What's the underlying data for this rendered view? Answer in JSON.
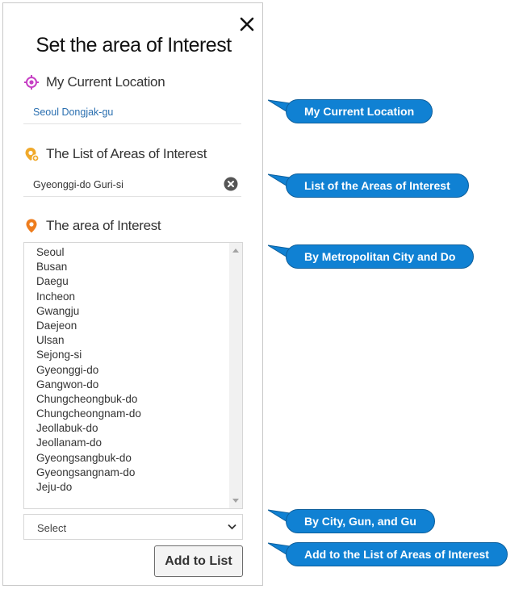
{
  "panel": {
    "title": "Set the area of Interest",
    "close_icon": "close-icon",
    "current_location": {
      "heading": "My Current Location",
      "icon": "target-location-icon",
      "icon_color": "#c63fc4",
      "value": "Seoul Dongjak-gu"
    },
    "interest_list": {
      "heading": "The List of Areas of Interest",
      "icon": "location-list-icon",
      "icon_color": "#f0a92b",
      "items": [
        "Gyeonggi-do Guri-si"
      ],
      "remove_icon": "remove-circle-icon"
    },
    "area": {
      "heading": "The area of Interest",
      "icon": "map-pin-icon",
      "icon_color": "#ee7d1e",
      "regions": [
        "Seoul",
        "Busan",
        "Daegu",
        "Incheon",
        "Gwangju",
        "Daejeon",
        "Ulsan",
        "Sejong-si",
        "Gyeonggi-do",
        "Gangwon-do",
        "Chungcheongbuk-do",
        "Chungcheongnam-do",
        "Jeollabuk-do",
        "Jeollanam-do",
        "Gyeongsangbuk-do",
        "Gyeongsangnam-do",
        "Jeju-do"
      ],
      "sub_select_value": "Select"
    },
    "add_button_label": "Add to List"
  },
  "callouts": [
    "My Current Location",
    "List of the Areas of Interest",
    "By Metropolitan City and Do",
    "By City, Gun, and Gu",
    "Add to the List of Areas of Interest"
  ],
  "colors": {
    "callout_fill": "#1081d3",
    "callout_border": "#0d5f9c",
    "current_location_text": "#2a6fb0"
  }
}
